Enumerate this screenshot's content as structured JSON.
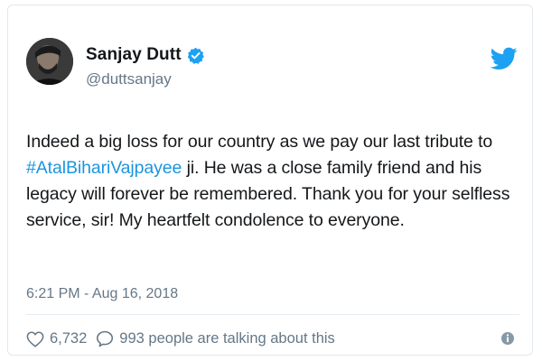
{
  "user": {
    "display_name": "Sanjay Dutt",
    "handle": "@duttsanjay",
    "verified": true,
    "avatar_icon": "user-avatar"
  },
  "tweet": {
    "text_before": "Indeed a big loss for our country as we pay our last tribute to ",
    "hashtag": "#AtalBihariVajpayee",
    "text_after": " ji. He was a close family friend and his legacy will forever be remembered. Thank you for your selfless service, sir! My heartfelt condolence to everyone.",
    "timestamp": "6:21 PM - Aug 16, 2018"
  },
  "actions": {
    "likes_count": "6,732",
    "talking_label": "993 people are talking about this"
  },
  "colors": {
    "twitter_blue": "#1da1f2",
    "hashtag": "#1b95e0",
    "muted": "#657786",
    "text": "#14171a"
  },
  "icons": {
    "brand": "twitter-bird-icon",
    "verified": "verified-badge-icon",
    "like": "heart-icon",
    "reply": "speech-bubble-icon",
    "info": "info-icon"
  }
}
